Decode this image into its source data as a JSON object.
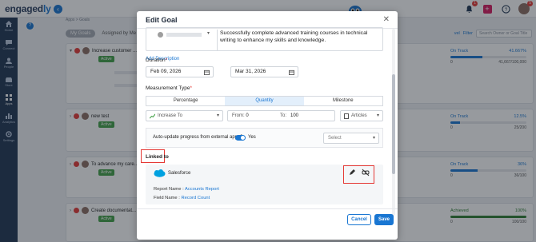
{
  "app": {
    "logo_main": "engaged",
    "logo_accent": "ly",
    "notif_count": "1",
    "tasks_count": "5"
  },
  "sidebar": {
    "items": [
      {
        "label": "Home"
      },
      {
        "label": "Connect"
      },
      {
        "label": "People"
      },
      {
        "label": "Store"
      },
      {
        "label": "Apps"
      },
      {
        "label": "Analytics"
      },
      {
        "label": "Settings"
      }
    ]
  },
  "page": {
    "breadcrumb": "Apps > Goals",
    "tabs": [
      "My Goals",
      "Assigned by Me"
    ],
    "filter_left": "vel",
    "filter_label": "Filter",
    "search_placeholder": "Search Owner or Goal Title"
  },
  "goals": [
    {
      "title": "Increase customer ...",
      "status": "Active",
      "state": "On Track",
      "pct": "41.667%",
      "value": 41.667,
      "left": "0",
      "right": "41,667/100,000"
    },
    {
      "title": "new test",
      "status": "Active",
      "state": "On Track",
      "pct": "12.5%",
      "value": 12.5,
      "left": "0",
      "right": "25/200"
    },
    {
      "title": "To advance my care...",
      "status": "Active",
      "state": "On Track",
      "pct": "36%",
      "value": 36,
      "left": "0",
      "right": "36/100"
    },
    {
      "title": "Create documentat...",
      "status": "Active",
      "state": "Achieved",
      "pct": "100%",
      "value": 100,
      "left": "0",
      "right": "100/100"
    }
  ],
  "modal": {
    "title": "Edit Goal",
    "description": "Successfully complete advanced training courses in technical writing to enhance my skills and knowledge.",
    "add_description": "Add Description",
    "duration_label": "Duration",
    "start_date": "Feb 09, 2026",
    "end_date": "Mar 31, 2026",
    "measurement_label": "Measurement Type",
    "measurement_options": [
      "Percentage",
      "Quantity",
      "Milestone"
    ],
    "increase_label": "Increase To",
    "from_label": "From:",
    "from_value": "0",
    "to_label": "To:",
    "to_value": "100",
    "unit": "Articles",
    "auto_update_label": "Auto-update progress from external apps?",
    "yes_label": "Yes",
    "select_placeholder": "Select",
    "linked_to_label": "Linked to",
    "integration_name": "Salesforce",
    "report_name_label": "Report Name :",
    "report_name_value": "Accounts Report",
    "field_name_label": "Field Name :",
    "field_name_value": "Record Count",
    "cancel_label": "Cancel",
    "save_label": "Save"
  },
  "colors": {
    "primary": "#1976d2",
    "danger": "#e53935",
    "success": "#43a047",
    "sidebar": "#1f3552"
  }
}
